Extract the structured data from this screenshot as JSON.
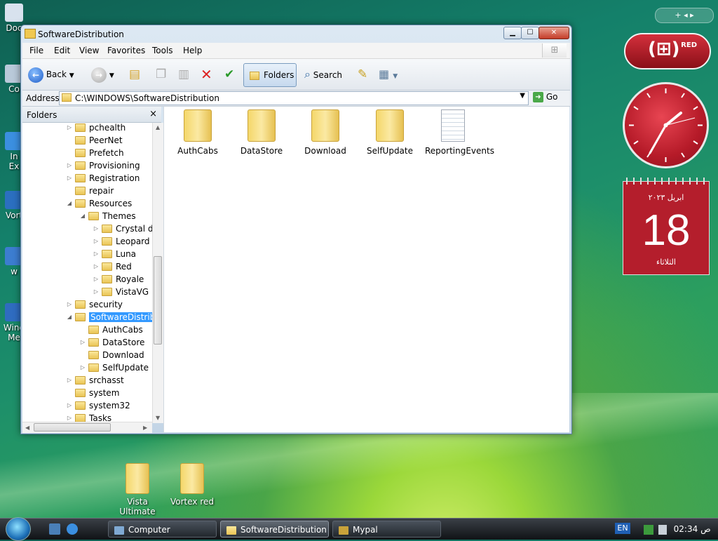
{
  "window": {
    "title": "SoftwareDistribution",
    "menu": [
      "File",
      "Edit",
      "View",
      "Favorites",
      "Tools",
      "Help"
    ],
    "toolbar": {
      "back": "Back",
      "folders": "Folders",
      "search": "Search"
    },
    "address": {
      "label": "Address",
      "value": "C:\\WINDOWS\\SoftwareDistribution",
      "go": "Go"
    },
    "folders_pane": {
      "title": "Folders",
      "close": "×",
      "items": [
        {
          "label": "pchealth",
          "level": 0,
          "exp": "▷"
        },
        {
          "label": "PeerNet",
          "level": 0,
          "exp": ""
        },
        {
          "label": "Prefetch",
          "level": 0,
          "exp": ""
        },
        {
          "label": "Provisioning",
          "level": 0,
          "exp": "▷"
        },
        {
          "label": "Registration",
          "level": 0,
          "exp": "▷"
        },
        {
          "label": "repair",
          "level": 0,
          "exp": ""
        },
        {
          "label": "Resources",
          "level": 0,
          "exp": "◢"
        },
        {
          "label": "Themes",
          "level": 1,
          "exp": "◢"
        },
        {
          "label": "Crystal d",
          "level": 2,
          "exp": "▷"
        },
        {
          "label": "Leopard",
          "level": 2,
          "exp": "▷"
        },
        {
          "label": "Luna",
          "level": 2,
          "exp": "▷"
        },
        {
          "label": "Red",
          "level": 2,
          "exp": "▷"
        },
        {
          "label": "Royale",
          "level": 2,
          "exp": "▷"
        },
        {
          "label": "VistaVG I",
          "level": 2,
          "exp": "▷"
        },
        {
          "label": "security",
          "level": 0,
          "exp": "▷"
        },
        {
          "label": "SoftwareDistrib",
          "level": 0,
          "exp": "◢",
          "selected": true
        },
        {
          "label": "AuthCabs",
          "level": 1,
          "exp": ""
        },
        {
          "label": "DataStore",
          "level": 1,
          "exp": "▷"
        },
        {
          "label": "Download",
          "level": 1,
          "exp": ""
        },
        {
          "label": "SelfUpdate",
          "level": 1,
          "exp": "▷"
        },
        {
          "label": "srchasst",
          "level": 0,
          "exp": "▷"
        },
        {
          "label": "system",
          "level": 0,
          "exp": ""
        },
        {
          "label": "system32",
          "level": 0,
          "exp": "▷"
        },
        {
          "label": "Tasks",
          "level": 0,
          "exp": "▷"
        }
      ]
    },
    "content_items": [
      {
        "label": "AuthCabs",
        "type": "folder"
      },
      {
        "label": "DataStore",
        "type": "folder"
      },
      {
        "label": "Download",
        "type": "folder"
      },
      {
        "label": "SelfUpdate",
        "type": "folder"
      },
      {
        "label": "ReportingEvents",
        "type": "file"
      }
    ]
  },
  "desktop": {
    "left_icons": [
      "Doc",
      "Co",
      "In\nEx",
      "Vort",
      "w",
      "Wind\nMe"
    ],
    "folders": [
      "Vista Ultimate",
      "Vortex red"
    ]
  },
  "gadgets": {
    "red_logo_text": "RED",
    "calendar": {
      "month": "ابريل ٢٠٢٣",
      "day": "18",
      "weekday": "الثلاثاء"
    },
    "clock_time": "02:34",
    "sidebar_controls": "+  ◂  ▸"
  },
  "taskbar": {
    "tasks": [
      {
        "label": "Computer",
        "active": false
      },
      {
        "label": "SoftwareDistribution",
        "active": true
      },
      {
        "label": "Mypal",
        "active": false
      }
    ],
    "lang": "EN",
    "time": "02:34 ص"
  },
  "colors": {
    "accent": "#3399ff",
    "gadget_red": "#b41e2c",
    "taskbar": "#1a1e22"
  },
  "icons": [
    "back-arrow-icon",
    "forward-arrow-icon",
    "up-folder-icon",
    "copy-icon",
    "move-icon",
    "delete-icon",
    "undo-check-icon",
    "folder-icon",
    "search-icon",
    "views-icon",
    "go-arrow-icon",
    "windows-logo-icon"
  ]
}
